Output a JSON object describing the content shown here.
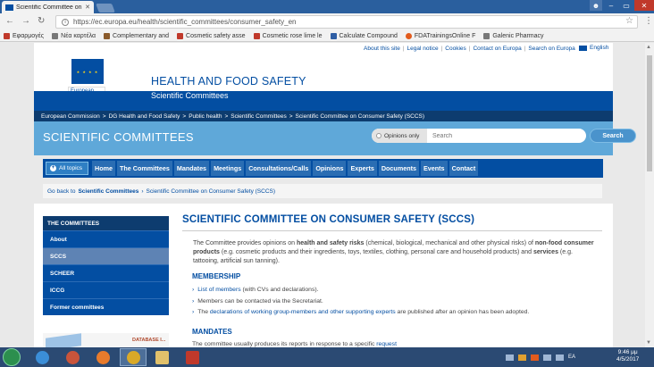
{
  "browser": {
    "tab_title": "Scientific Committee on",
    "url": "https://ec.europa.eu/health/scientific_committees/consumer_safety_en",
    "bookmarks": [
      {
        "label": "Εφαρμογές",
        "color": "#c0392b"
      },
      {
        "label": "Νέα καρτέλα",
        "color": "#777777"
      },
      {
        "label": "Complementary and",
        "color": "#8a5a2b"
      },
      {
        "label": "Cosmetic safety asse",
        "color": "#c0392b"
      },
      {
        "label": "Cosmetic rose lime le",
        "color": "#c0392b"
      },
      {
        "label": "Calculate Compound",
        "color": "#2f5fa5"
      },
      {
        "label": "FDATrainingsOnline F",
        "color": "#e25b1d"
      },
      {
        "label": "Galenic Pharmacy",
        "color": "#777777"
      }
    ]
  },
  "header": {
    "logo_text": "European Commission",
    "title": "HEALTH AND FOOD SAFETY",
    "subtitle": "Scientific Committees",
    "top_links": [
      "About this site",
      "Legal notice",
      "Cookies",
      "Contact on Europa",
      "Search on Europa"
    ],
    "language": "English"
  },
  "breadcrumb": [
    "European Commission",
    "DG Health and Food Safety",
    "Public health",
    "Scientific Committees",
    "Scientific Committee on Consumer Safety (SCCS)"
  ],
  "banner": {
    "title": "SCIENTIFIC COMMITTEES",
    "opinions_only": "Opinions only",
    "search_placeholder": "Search",
    "search_button": "Search"
  },
  "nav": {
    "all_topics": "All topics",
    "items": [
      "Home",
      "The Committees",
      "Mandates",
      "Meetings",
      "Consultations/Calls",
      "Opinions",
      "Experts",
      "Documents",
      "Events",
      "Contact"
    ]
  },
  "goback": {
    "prefix": "Go back to",
    "parent": "Scientific Committees",
    "current": "Scientific Committee on Consumer Safety (SCCS)"
  },
  "sidebar": {
    "heading": "THE COMMITTEES",
    "items": [
      "About",
      "SCCS",
      "SCHEER",
      "ICCG",
      "Former committees"
    ],
    "banner_text": "DATABASE I..."
  },
  "main": {
    "title": "SCIENTIFIC COMMITTEE ON CONSUMER SAFETY (SCCS)",
    "intro": {
      "p1": "The Committee provides opinions on ",
      "b1": "health and safety risks",
      "p2": " (chemical, biological, mechanical and other physical risks) of ",
      "b2": "non-food consumer products",
      "p3": " (e.g. cosmetic products and their ingredients, toys, textiles, clothing, personal care and household products) and ",
      "b3": "services",
      "p4": " (e.g. tattooing, artificial sun tanning)."
    },
    "membership_title": "MEMBERSHIP",
    "membership_bullets": [
      {
        "link": "List of members",
        "text": " (with CVs and declarations)."
      },
      {
        "link": "",
        "text": "Members can be contacted via the Secretariat."
      },
      {
        "link": "declarations of working group-members and other supporting experts",
        "pre": "The ",
        "text": " are published after an opinion has been adopted."
      }
    ],
    "mandates_title": "MANDATES",
    "mandates_text": "The committee usually produces its reports in response to a specific ",
    "mandates_link": "request"
  },
  "taskbar": {
    "time": "9:46 μμ",
    "date": "4/5/2017",
    "lang": "EA"
  },
  "colors": {
    "ec_blue": "#034ea2",
    "banner_blue": "#5fa8d9",
    "taskbar": "#2b4a73"
  }
}
